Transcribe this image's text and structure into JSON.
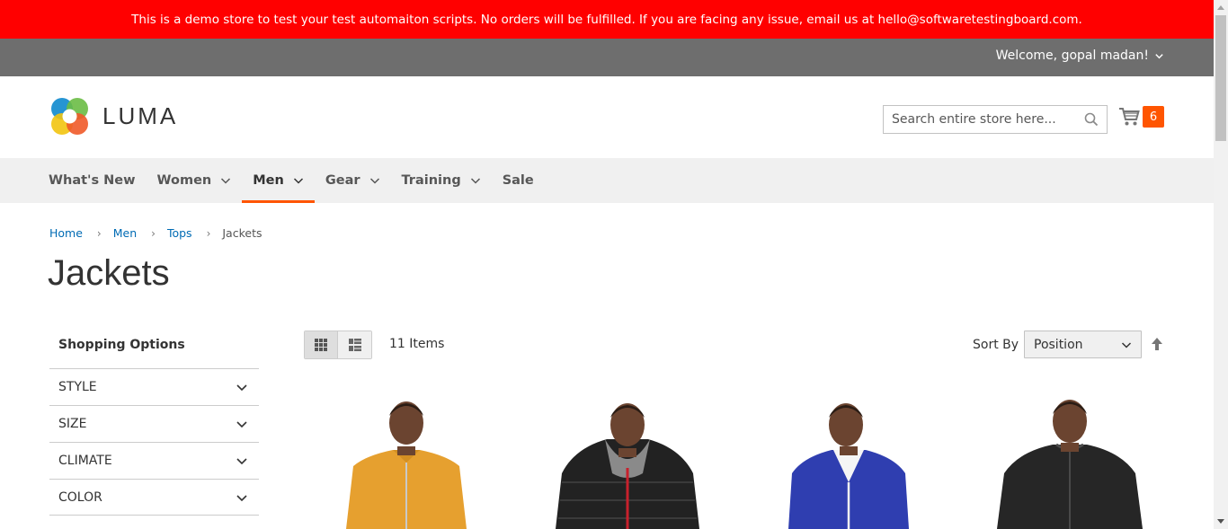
{
  "banner": {
    "text": "This is a demo store to test your test automaiton scripts. No orders will be fulfilled. If you are facing any issue, email us at hello@softwaretestingboard.com."
  },
  "header": {
    "welcome": "Welcome, gopal madan!"
  },
  "logo": {
    "text": "LUMA"
  },
  "search": {
    "placeholder": "Search entire store here..."
  },
  "cart": {
    "count": "6"
  },
  "nav": {
    "items": [
      {
        "label": "What's New"
      },
      {
        "label": "Women"
      },
      {
        "label": "Men"
      },
      {
        "label": "Gear"
      },
      {
        "label": "Training"
      },
      {
        "label": "Sale"
      }
    ],
    "active": "Men"
  },
  "breadcrumbs": {
    "items": [
      "Home",
      "Men",
      "Tops"
    ],
    "current": "Jackets"
  },
  "page": {
    "title": "Jackets"
  },
  "sidebar": {
    "title": "Shopping Options",
    "filters": [
      "STYLE",
      "SIZE",
      "CLIMATE",
      "COLOR"
    ]
  },
  "toolbar": {
    "items_count": "11",
    "items_label": "Items",
    "sort_label": "Sort By",
    "sort_value": "Position"
  },
  "products": [
    {
      "jacket_color": "#e8a230",
      "icon": "orange-quarter-zip-jacket"
    },
    {
      "jacket_color": "#222222",
      "icon": "black-puffer-jacket"
    },
    {
      "jacket_color": "#2f3eb0",
      "icon": "blue-track-jacket"
    },
    {
      "jacket_color": "#262626",
      "icon": "black-bomber-jacket"
    }
  ],
  "colors": {
    "banner": "#ff0000",
    "header_panel": "#6e6e6e",
    "accent": "#ff5501",
    "link": "#006bb4",
    "nav_bg": "#f0f0f0"
  }
}
